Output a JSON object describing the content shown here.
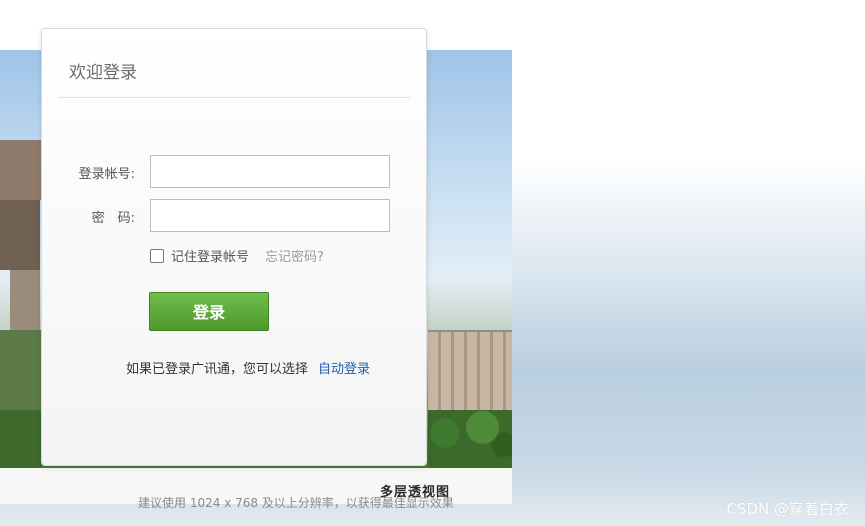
{
  "login": {
    "title": "欢迎登录",
    "account_label": "登录帐号:",
    "account_value": "",
    "password_label": "密　码:",
    "password_value": "",
    "remember_label": "记住登录帐号",
    "forgot_link": "忘记密码?",
    "submit_label": "登录",
    "auto_login_prompt": "如果已登录广讯通，您可以选择",
    "auto_login_link": "自动登录"
  },
  "background": {
    "photo_caption": "多层透视图"
  },
  "footer": {
    "hint": "建议使用 1024 x 768 及以上分辨率，以获得最佳显示效果"
  },
  "watermark": "CSDN @穿着白衣",
  "colors": {
    "login_button": "#5aa936",
    "link": "#1f5fa8"
  }
}
